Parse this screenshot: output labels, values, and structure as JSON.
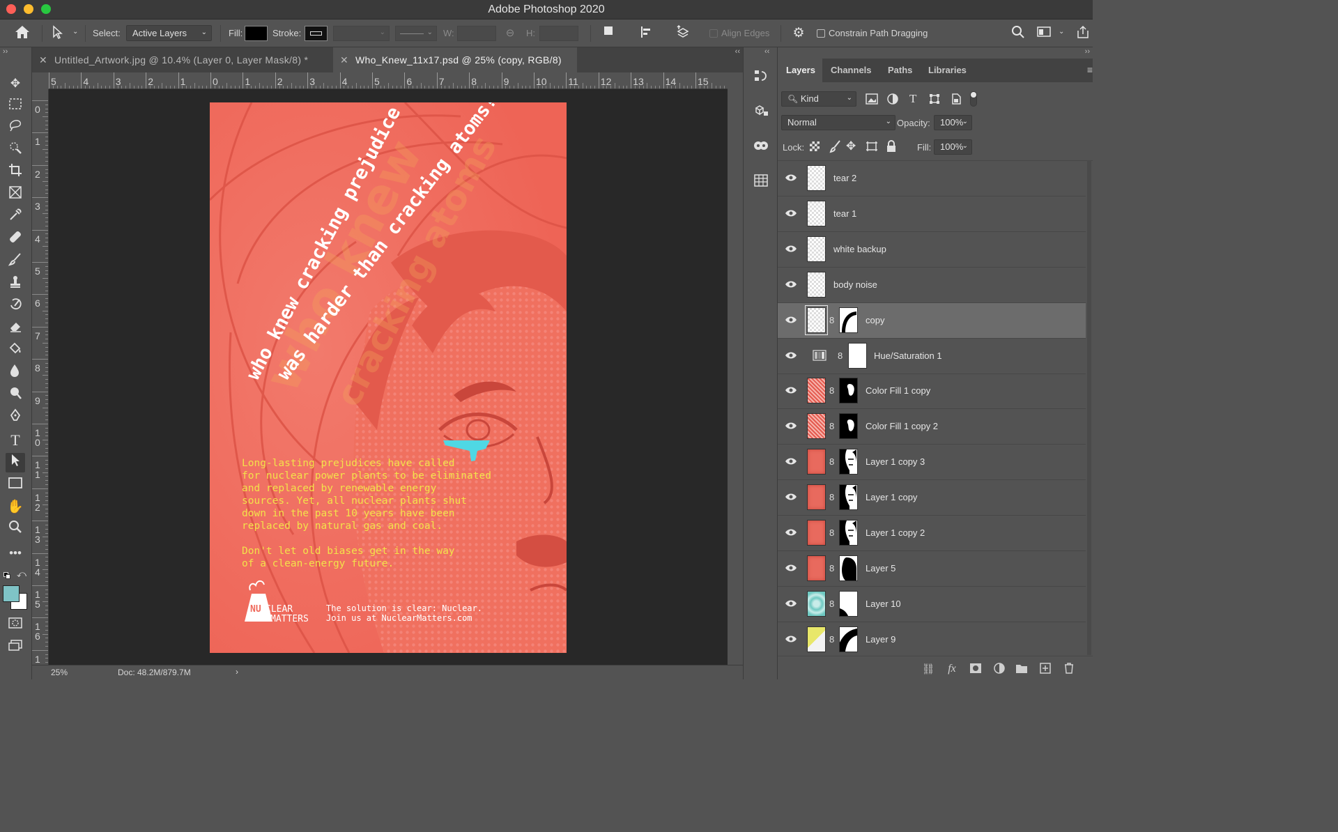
{
  "window": {
    "title": "Adobe Photoshop 2020",
    "colors": {
      "close": "#fe5f57",
      "minimize": "#febc2e",
      "maximize": "#28c840"
    }
  },
  "options_bar": {
    "select_label": "Select:",
    "select_value": "Active Layers",
    "fill_label": "Fill:",
    "stroke_label": "Stroke:",
    "w_label": "W:",
    "h_label": "H:",
    "align_edges": "Align Edges",
    "constrain_path": "Constrain Path Dragging",
    "icons": [
      "home-icon",
      "path-select-icon",
      "link-icon",
      "path-ops-icon",
      "path-align-icon",
      "path-arrange-icon",
      "gear-icon",
      "search-icon",
      "workspace-icon",
      "share-icon"
    ]
  },
  "tabs": [
    {
      "label": "Untitled_Artwork.jpg @ 10.4% (Layer 0, Layer Mask/8) *",
      "active": false
    },
    {
      "label": "Who_Knew_11x17.psd @ 25% (copy, RGB/8)",
      "active": true
    }
  ],
  "ruler": {
    "top": [
      "5",
      "4",
      "3",
      "2",
      "1",
      "0",
      "1",
      "2",
      "3",
      "4",
      "5",
      "6",
      "7",
      "8",
      "9",
      "10",
      "11",
      "12",
      "13",
      "14",
      "15"
    ],
    "left": [
      "0",
      "1",
      "2",
      "3",
      "4",
      "5",
      "6",
      "7",
      "8",
      "9",
      "1 0",
      "1 1",
      "1 2",
      "1 3",
      "1 4",
      "1 5",
      "1 6",
      "1"
    ]
  },
  "poster": {
    "headline_line1": "who knew cracking prejudice",
    "headline_line2": "was harder than cracking atoms?",
    "body1": [
      "Long-lasting prejudices have called",
      "for nuclear power plants to be eliminated",
      "and replaced by renewable energy",
      "sources. Yet, all nuclear plants shut",
      "down in the past 10 years have been",
      "replaced by natural gas and coal."
    ],
    "body2": [
      "Don't let old biases get in the way",
      "of a clean-energy future."
    ],
    "logo_nu": "NU",
    "logo_clear": "CLEAR",
    "logo_matters": "MATTERS",
    "footer1": "The solution is clear: Nuclear.",
    "footer2": "Join us at NuclearMatters.com",
    "colors": {
      "bg": "#ef6b5d",
      "text_yellow": "#f3e24a",
      "white": "#ffffff",
      "tear": "#4fd8e4"
    }
  },
  "status": {
    "zoom": "25%",
    "doc": "Doc: 48.2M/879.7M"
  },
  "layers_panel": {
    "tabs": [
      "Layers",
      "Channels",
      "Paths",
      "Libraries"
    ],
    "kind_label": "Kind",
    "blend_mode": "Normal",
    "opacity_label": "Opacity:",
    "opacity_value": "100%",
    "lock_label": "Lock:",
    "fill_label": "Fill:",
    "fill_value": "100%",
    "layers": [
      {
        "name": "tear 2",
        "thumb": "checker",
        "mask": ""
      },
      {
        "name": "tear 1",
        "thumb": "checker",
        "mask": ""
      },
      {
        "name": "white backup",
        "thumb": "checker",
        "mask": ""
      },
      {
        "name": "body noise",
        "thumb": "checker",
        "mask": ""
      },
      {
        "name": "copy",
        "thumb": "checker",
        "mask": "curve",
        "selected": true
      },
      {
        "name": "Hue/Saturation 1",
        "thumb": "adjust",
        "mask": "white"
      },
      {
        "name": "Color Fill 1 copy",
        "thumb": "redpat",
        "mask": "face"
      },
      {
        "name": "Color Fill 1 copy 2",
        "thumb": "redpat",
        "mask": "face"
      },
      {
        "name": "Layer 1 copy 3",
        "thumb": "red",
        "mask": "face-w"
      },
      {
        "name": "Layer 1 copy",
        "thumb": "red",
        "mask": "face-w"
      },
      {
        "name": "Layer 1 copy 2",
        "thumb": "red",
        "mask": "face-w"
      },
      {
        "name": "Layer 5",
        "thumb": "red",
        "mask": "blob"
      },
      {
        "name": "Layer 10",
        "thumb": "teal",
        "mask": "blob-w"
      },
      {
        "name": "Layer 9",
        "thumb": "yellow",
        "mask": "stroke"
      }
    ],
    "footer_icons": [
      "link-layers-icon",
      "fx-icon",
      "mask-icon",
      "adjustment-icon",
      "group-icon",
      "new-layer-icon",
      "trash-icon"
    ]
  }
}
